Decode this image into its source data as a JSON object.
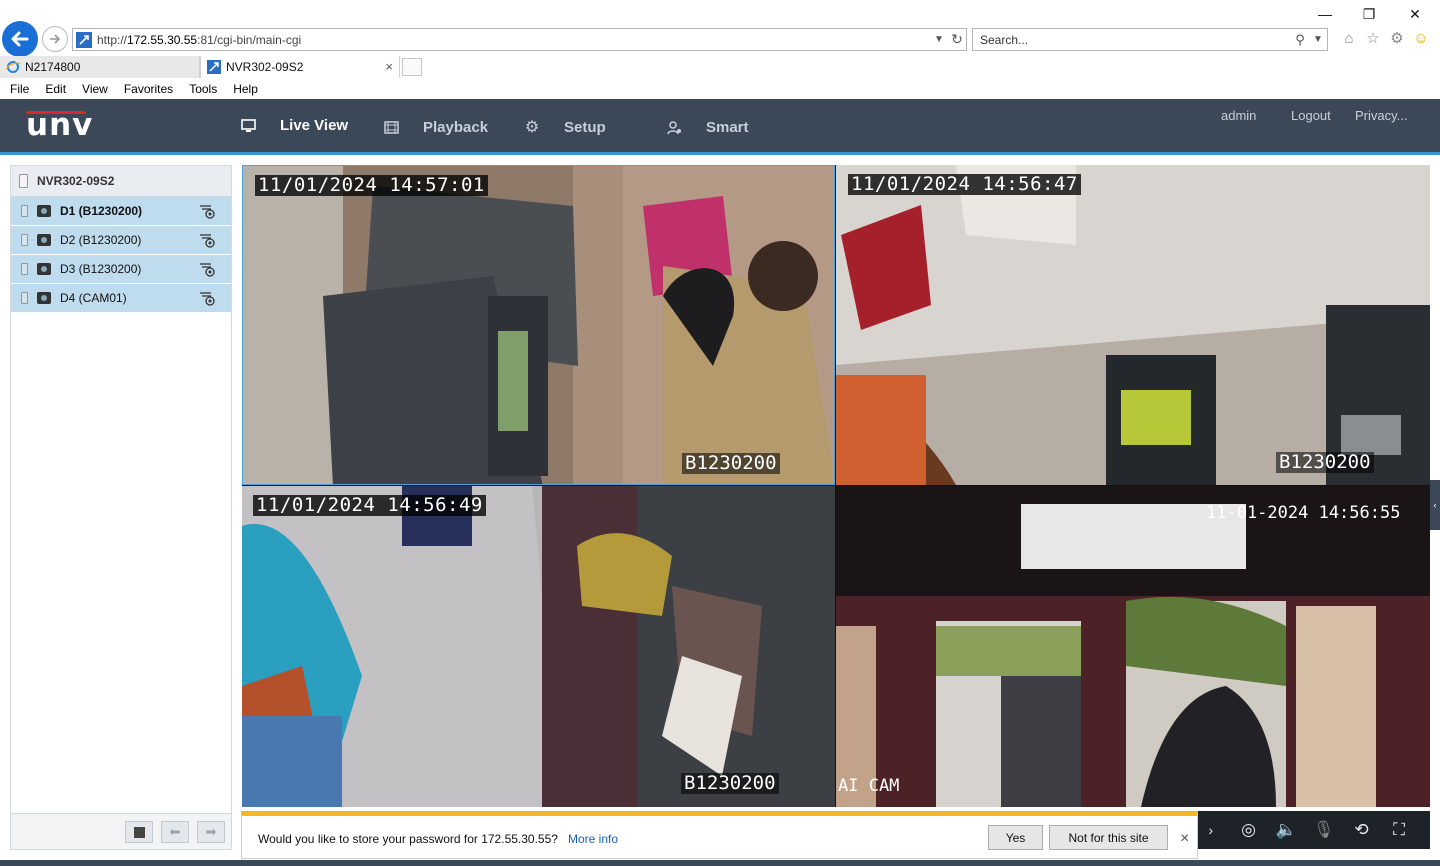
{
  "browser": {
    "url_prefix": "http://",
    "url_host": "172.55.30.55",
    "url_rest": ":81/cgi-bin/main-cgi",
    "search_placeholder": "Search...",
    "tabs": [
      {
        "label": "N2174800"
      },
      {
        "label": "NVR302-09S2"
      }
    ],
    "tab_close": "×",
    "menu": [
      "File",
      "Edit",
      "View",
      "Favorites",
      "Tools",
      "Help"
    ]
  },
  "app": {
    "logo": "unv",
    "nav": [
      {
        "label": "Live View",
        "icon": "monitor-icon"
      },
      {
        "label": "Playback",
        "icon": "film-icon"
      },
      {
        "label": "Setup",
        "icon": "gear-icon"
      },
      {
        "label": "Smart",
        "icon": "person-icon"
      }
    ],
    "header_links": [
      "admin",
      "Logout",
      "Privacy..."
    ]
  },
  "sidebar": {
    "device": "NVR302-09S2",
    "channels": [
      {
        "label": "D1 (B1230200)"
      },
      {
        "label": "D2 (B1230200)"
      },
      {
        "label": "D3 (B1230200)"
      },
      {
        "label": "D4 (CAM01)"
      }
    ]
  },
  "video": {
    "tiles": [
      {
        "timestamp": "11/01/2024 14:57:01",
        "name": "B1230200"
      },
      {
        "timestamp": "11/01/2024 14:56:47",
        "name": "B1230200"
      },
      {
        "timestamp": "11/01/2024 14:56:49",
        "name": "B1230200"
      },
      {
        "timestamp": "11-01-2024 14:56:55",
        "name": "AI CAM"
      }
    ]
  },
  "notification": {
    "message": "Would you like to store your password for 172.55.30.55?",
    "more_info": "More info",
    "yes_label": "Yes",
    "no_label": "Not for this site",
    "close": "×"
  },
  "colors": {
    "header_bg": "#3a4858",
    "accent": "#3c93d0",
    "channel_selected": "#bfdcee",
    "notify_bar": "#f3b724"
  }
}
